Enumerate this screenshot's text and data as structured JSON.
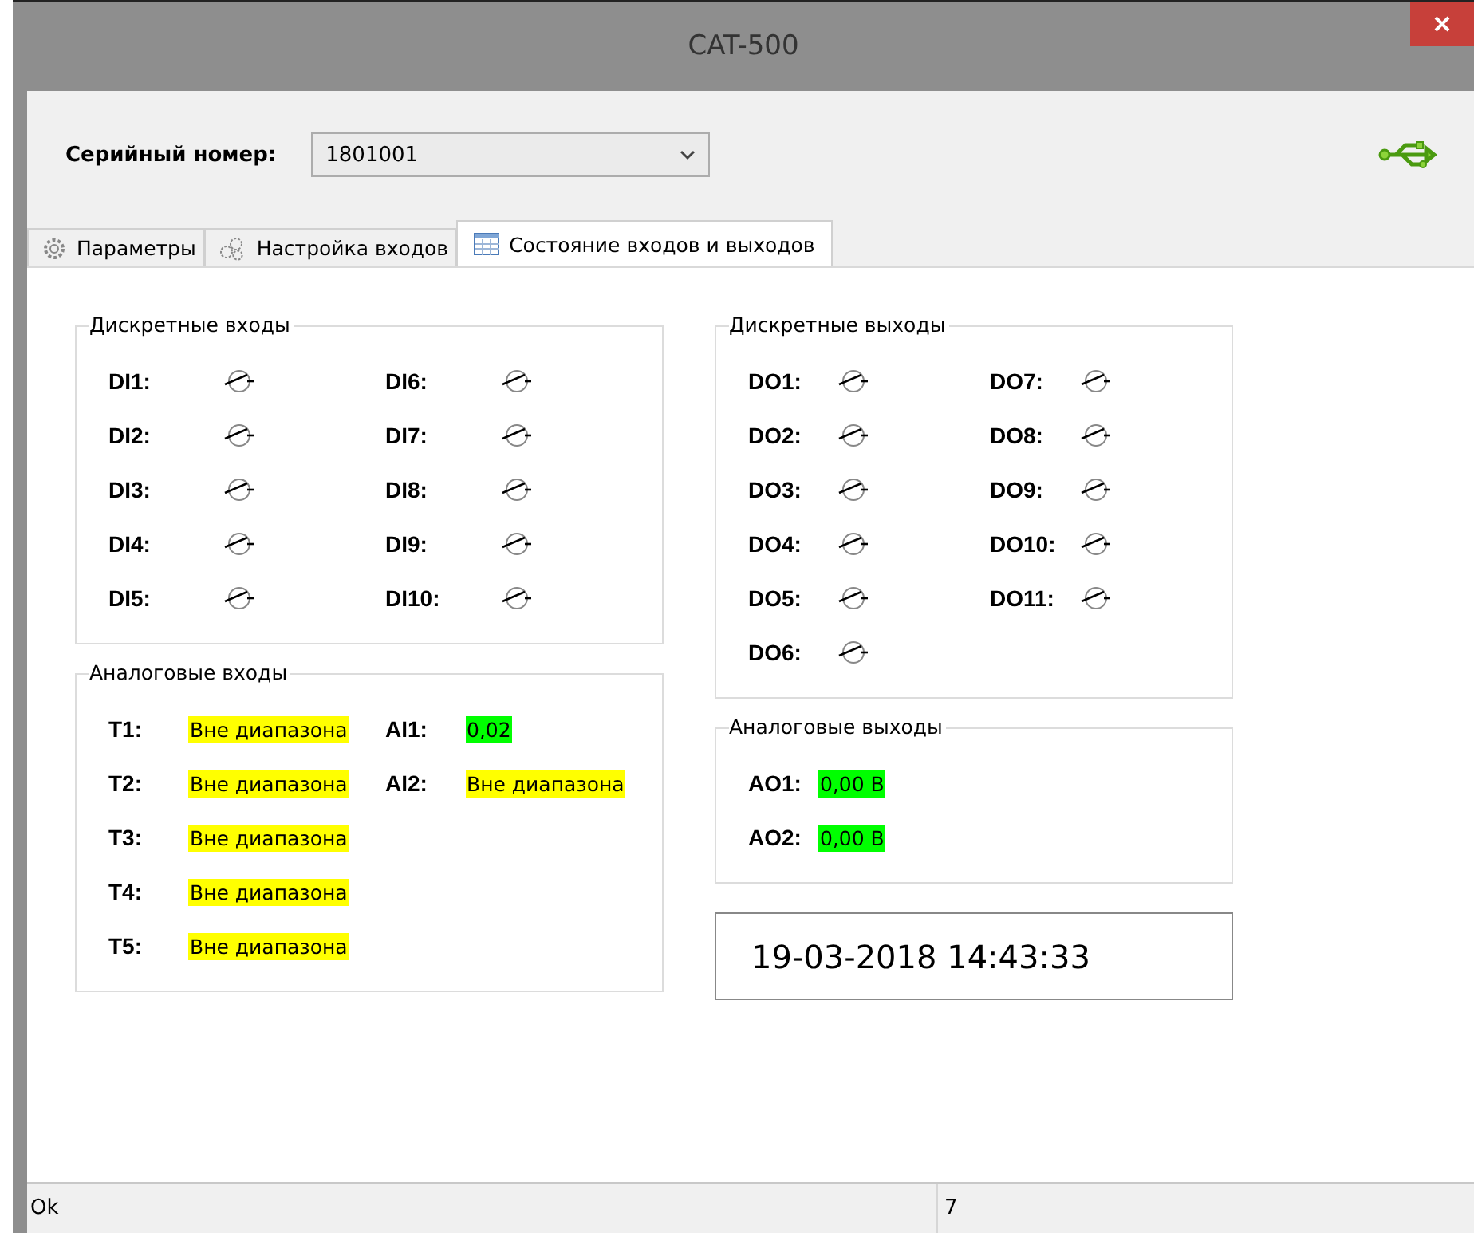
{
  "window": {
    "title": "CAT-500"
  },
  "serial": {
    "label": "Серийный номер:",
    "value": "1801001"
  },
  "tabs": [
    {
      "label": "Параметры",
      "kind": "gear",
      "selected": false
    },
    {
      "label": "Настройка входов",
      "kind": "gears",
      "selected": false
    },
    {
      "label": "Состояние входов и выходов",
      "kind": "table",
      "selected": true
    }
  ],
  "discrete_inputs": {
    "title": "Дискретные входы",
    "columns": [
      [
        {
          "label": "DI1:",
          "on": false
        },
        {
          "label": "DI2:",
          "on": false
        },
        {
          "label": "DI3:",
          "on": false
        },
        {
          "label": "DI4:",
          "on": false
        },
        {
          "label": "DI5:",
          "on": false
        }
      ],
      [
        {
          "label": "DI6:",
          "on": false
        },
        {
          "label": "DI7:",
          "on": false
        },
        {
          "label": "DI8:",
          "on": false
        },
        {
          "label": "DI9:",
          "on": false
        },
        {
          "label": "DI10:",
          "on": false
        }
      ]
    ]
  },
  "analog_inputs": {
    "title": "Аналоговые входы",
    "columns": [
      [
        {
          "label": "T1:",
          "value": "Вне диапазона",
          "color": "#ffff00"
        },
        {
          "label": "T2:",
          "value": "Вне диапазона",
          "color": "#ffff00"
        },
        {
          "label": "T3:",
          "value": "Вне диапазона",
          "color": "#ffff00"
        },
        {
          "label": "T4:",
          "value": "Вне диапазона",
          "color": "#ffff00"
        },
        {
          "label": "T5:",
          "value": "Вне диапазона",
          "color": "#ffff00"
        }
      ],
      [
        {
          "label": "AI1:",
          "value": "0,02",
          "color": "#00ff00"
        },
        {
          "label": "AI2:",
          "value": "Вне диапазона",
          "color": "#ffff00"
        }
      ]
    ]
  },
  "discrete_outputs": {
    "title": "Дискретные выходы",
    "columns": [
      [
        {
          "label": "DO1:",
          "on": false
        },
        {
          "label": "DO2:",
          "on": false
        },
        {
          "label": "DO3:",
          "on": false
        },
        {
          "label": "DO4:",
          "on": false
        },
        {
          "label": "DO5:",
          "on": false
        },
        {
          "label": "DO6:",
          "on": false
        }
      ],
      [
        {
          "label": "DO7:",
          "on": false
        },
        {
          "label": "DO8:",
          "on": false
        },
        {
          "label": "DO9:",
          "on": false
        },
        {
          "label": "DO10:",
          "on": false
        },
        {
          "label": "DO11:",
          "on": false
        }
      ]
    ]
  },
  "analog_outputs": {
    "title": "Аналоговые выходы",
    "columns": [
      [
        {
          "label": "AO1:",
          "value": "0,00 В",
          "color": "#00ff00"
        },
        {
          "label": "AO2:",
          "value": "0,00 В",
          "color": "#00ff00"
        }
      ]
    ]
  },
  "clock": "19-03-2018 14:43:33",
  "status_bar": [
    "Ok",
    "7"
  ]
}
